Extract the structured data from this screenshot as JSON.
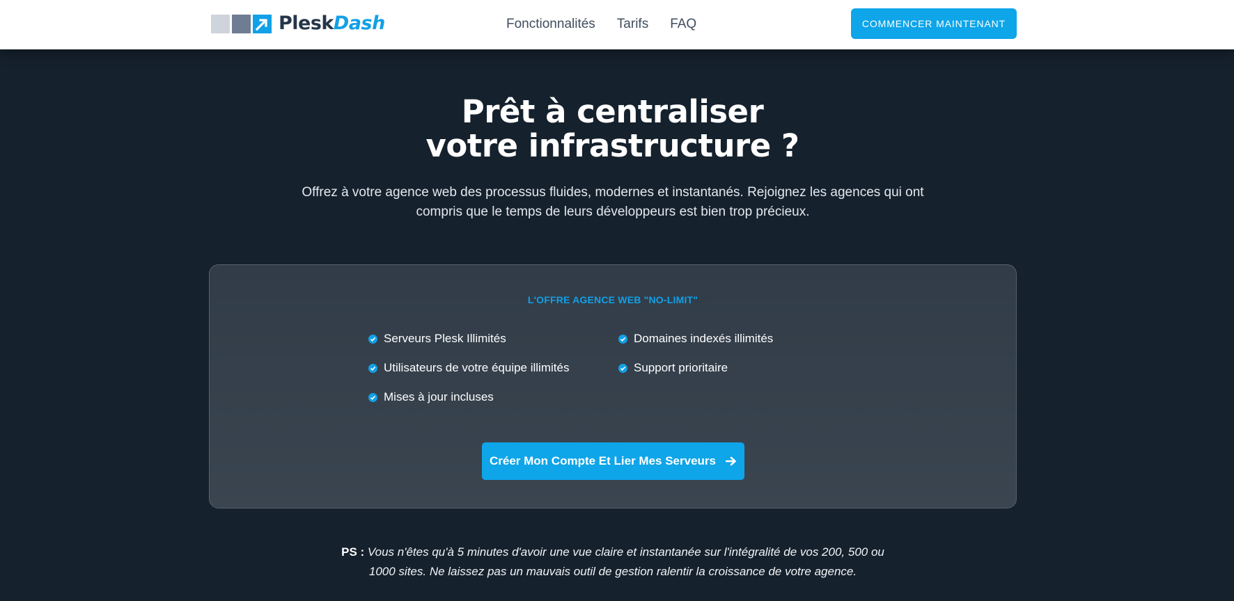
{
  "brand": {
    "name_part1": "Plesk",
    "name_part2": "Dash"
  },
  "nav": {
    "links": [
      "Fonctionnalités",
      "Tarifs",
      "FAQ"
    ],
    "cta_label": "COMMENCER MAINTENANT"
  },
  "hero": {
    "title_line1": "Prêt à centraliser",
    "title_line2": "votre infrastructure ?",
    "subtitle": "Offrez à votre agence web des processus fluides, modernes et instantanés. Rejoignez les agences qui ont compris que le temps de leurs développeurs est bien trop précieux."
  },
  "offer": {
    "title": "L'OFFRE AGENCE WEB \"NO-LIMIT\"",
    "features_left": [
      "Serveurs Plesk Illimités",
      "Utilisateurs de votre équipe illimités",
      "Mises à jour incluses"
    ],
    "features_right": [
      "Domaines indexés illimités",
      "Support prioritaire"
    ],
    "cta_label": "Créer Mon Compte Et Lier Mes Serveurs"
  },
  "ps": {
    "label": "PS :",
    "text": "Vous n'êtes qu'à 5 minutes d'avoir une vue claire et instantanée sur l'intégralité de vos 200, 500 ou 1000 sites. Ne laissez pas un mauvais outil de gestion ralentir la croissance de votre agence."
  },
  "colors": {
    "accent": "#0ea5e9",
    "background": "#15212d",
    "card": "#343f4b",
    "navbar": "#ffffff"
  }
}
